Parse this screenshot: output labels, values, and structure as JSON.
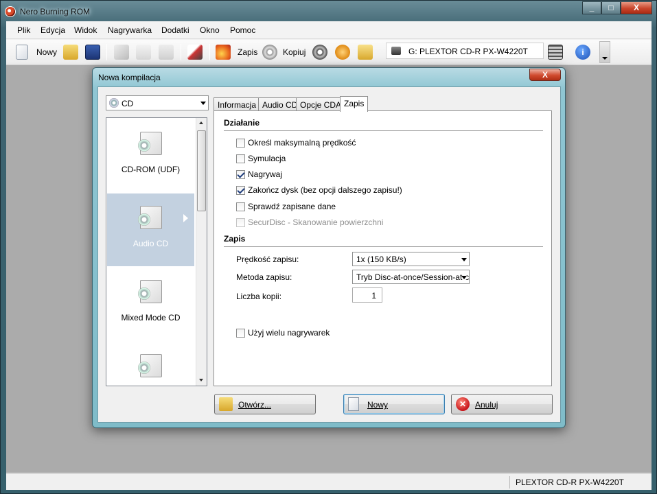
{
  "window": {
    "title": "Nero Burning ROM",
    "cap_min": "_",
    "cap_max": "□",
    "cap_close": "X"
  },
  "menu": {
    "items": [
      "Plik",
      "Edycja",
      "Widok",
      "Nagrywarka",
      "Dodatki",
      "Okno",
      "Pomoc"
    ]
  },
  "toolbar": {
    "new_label": "Nowy",
    "burn_label": "Zapis",
    "copy_label": "Kopiuj",
    "drive_label": "G: PLEXTOR CD-R  PX-W4220T"
  },
  "status": {
    "drive": "PLEXTOR  CD-R   PX-W4220T"
  },
  "dialog": {
    "title": "Nowa kompilacja",
    "close": "X",
    "disc_type": "CD",
    "categories": [
      {
        "label": "CD-ROM (UDF)"
      },
      {
        "label": "Audio CD"
      },
      {
        "label": "Mixed Mode CD"
      },
      {
        "label": ""
      }
    ],
    "tabs": [
      "Informacja",
      "Audio CD",
      "Opcje CDA",
      "Zapis"
    ],
    "section_action": "Działanie",
    "options": [
      {
        "label": "Określ maksymalną prędkość",
        "checked": false,
        "enabled": true
      },
      {
        "label": "Symulacja",
        "checked": false,
        "enabled": true
      },
      {
        "label": "Nagrywaj",
        "checked": true,
        "enabled": true
      },
      {
        "label": "Zakończ dysk (bez opcji dalszego zapisu!)",
        "checked": true,
        "enabled": true
      },
      {
        "label": "Sprawdź zapisane dane",
        "checked": false,
        "enabled": true
      },
      {
        "label": "SecurDisc - Skanowanie powierzchni",
        "checked": false,
        "enabled": false
      }
    ],
    "section_write": "Zapis",
    "speed_label": "Prędkość zapisu:",
    "speed_value": "1x (150 KB/s)",
    "method_label": "Metoda zapisu:",
    "method_value": "Tryb Disc-at-once/Session-at-c",
    "copies_label": "Liczba kopii:",
    "copies_value": "1",
    "multi_burner_label": "Użyj wielu nagrywarek",
    "multi_burner_checked": false,
    "btn_open": "Otwórz...",
    "btn_new": "Nowy",
    "btn_cancel": "Anuluj"
  }
}
